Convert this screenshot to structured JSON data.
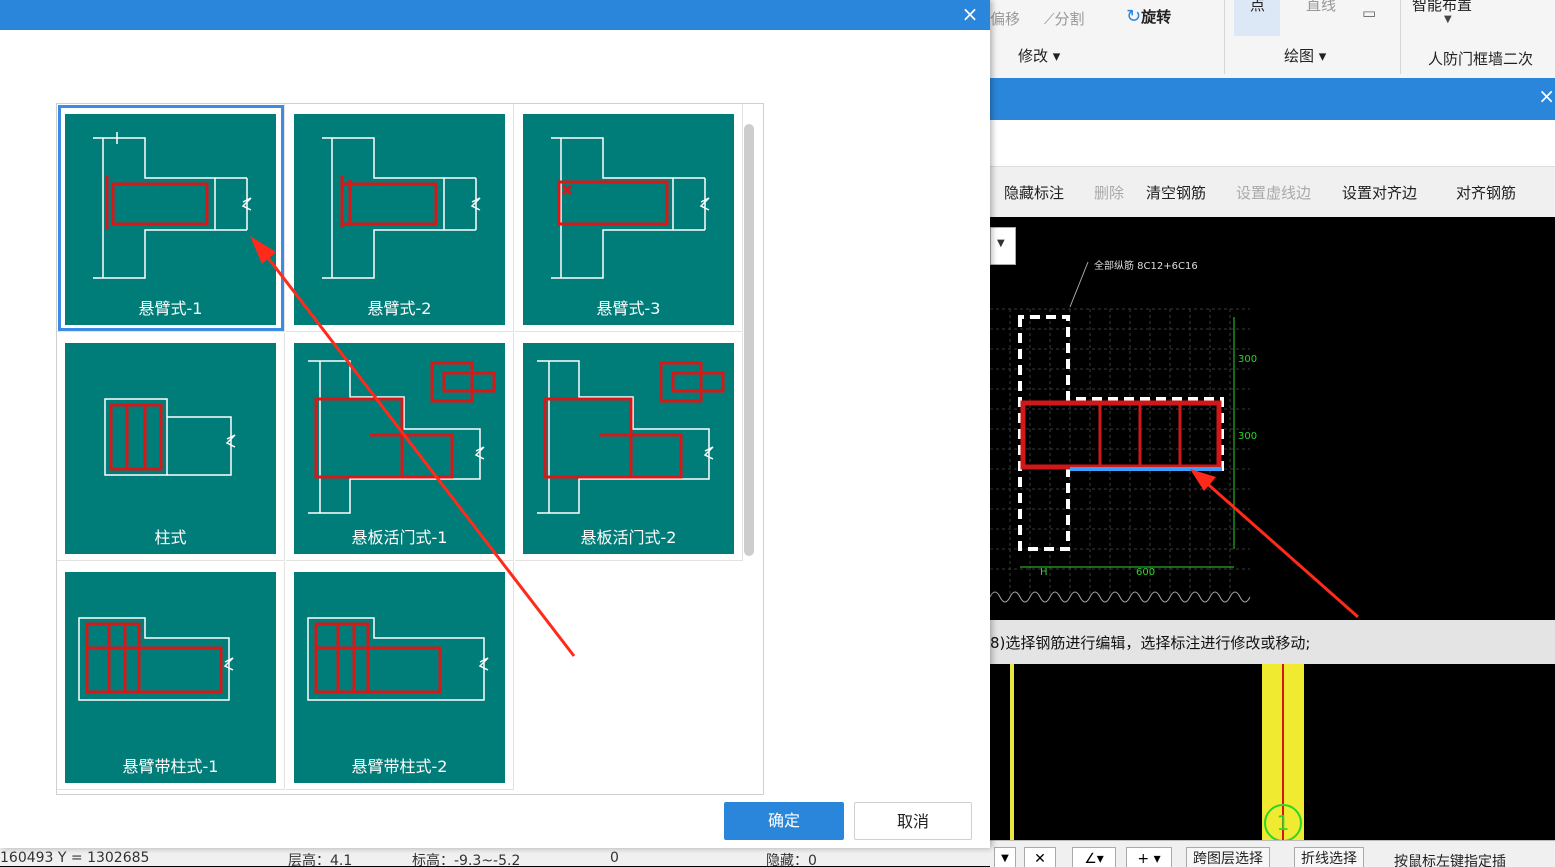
{
  "app": {
    "ribbon": {
      "offset_label": "偏移",
      "split_label": "分割",
      "rotate_label": "旋转",
      "modify_group": "修改",
      "point_label": "点",
      "line_label": "直线",
      "draw_group": "绘图",
      "smart_layout_label": "智能布置",
      "civil_defense_label": "人防门框墙二次"
    },
    "close_glyph": "×",
    "toolbar": {
      "hide_annotation": "隐藏标注",
      "delete": "删除",
      "clear_rebar": "清空钢筋",
      "set_dashed_edge": "设置虚线边",
      "set_align_edge": "设置对齐边",
      "align_rebar": "对齐钢筋"
    },
    "canvas": {
      "longitudinal_rebar_note": "全部纵筋 8C12+6C16",
      "dim_600": "600",
      "dim_300_top": "300",
      "dim_300_mid": "300",
      "dim_h": "H"
    },
    "status_text": "8)选择钢筋进行编辑，选择标注进行修改或移动;",
    "marker_label": "1",
    "bottom_buttons": [
      "跨图层选择",
      "折线选择",
      "按鼠标左键指定插"
    ],
    "left_status": {
      "coords": "160493 Y = 1302685",
      "floor": "层高：4.1",
      "elevation": "标高：-9.3~-5.2",
      "zero": "0",
      "hidden": "隐藏：0"
    },
    "colors": {
      "accent_blue": "#2a86da",
      "thumb_teal": "#007d79",
      "rebar_red": "#e01010",
      "dim_green": "#2bd62b"
    }
  },
  "dialog": {
    "close_glyph": "×",
    "options": [
      {
        "label": "悬臂式-1",
        "selected": true
      },
      {
        "label": "悬臂式-2",
        "selected": false
      },
      {
        "label": "悬臂式-3",
        "selected": false
      },
      {
        "label": "柱式",
        "selected": false
      },
      {
        "label": "悬板活门式-1",
        "selected": false
      },
      {
        "label": "悬板活门式-2",
        "selected": false
      },
      {
        "label": "悬臂带柱式-1",
        "selected": false
      },
      {
        "label": "悬臂带柱式-2",
        "selected": false
      }
    ],
    "ok_label": "确定",
    "cancel_label": "取消"
  }
}
